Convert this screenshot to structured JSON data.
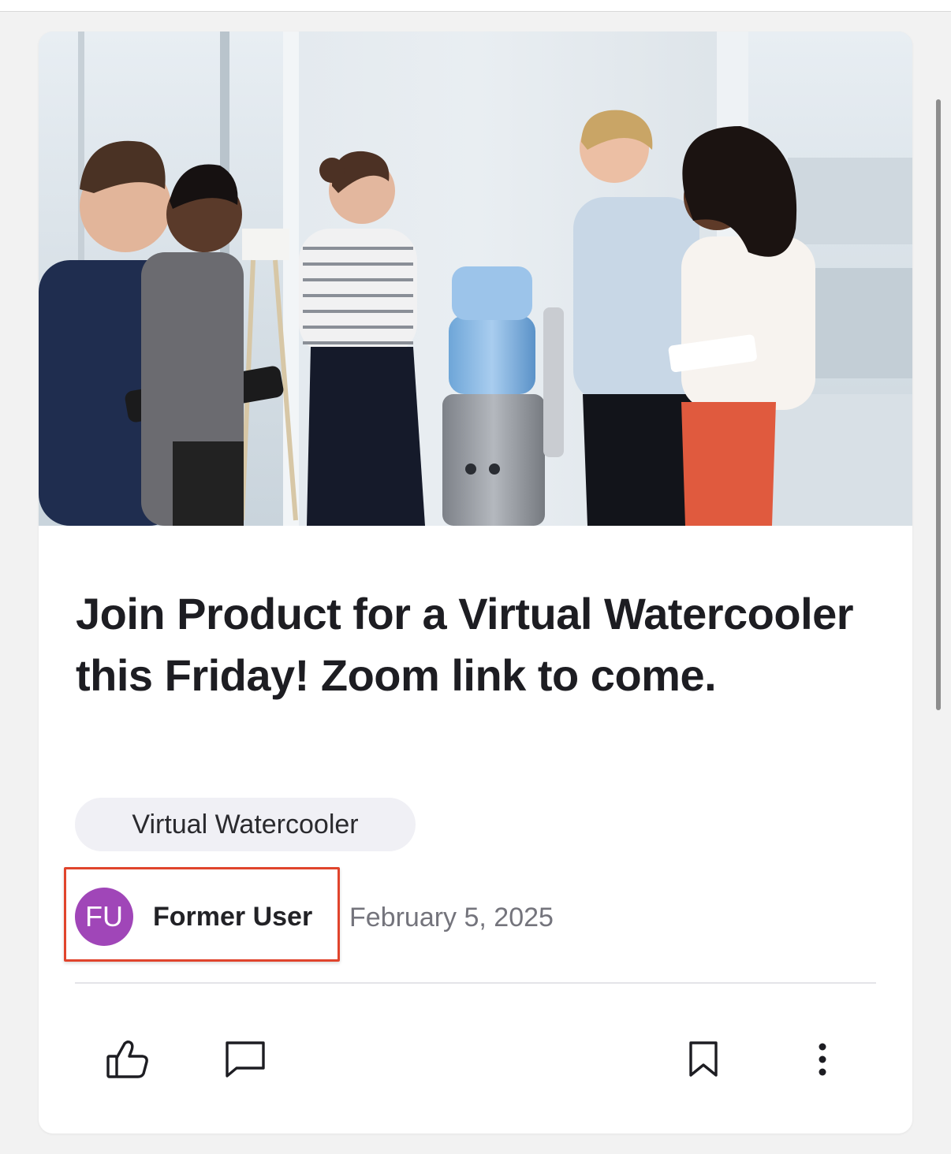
{
  "post": {
    "title": "Join Product for a Virtual Watercooler this Friday! Zoom link to come.",
    "tag": "Virtual Watercooler",
    "author": {
      "initials": "FU",
      "name": "Former User",
      "avatar_color": "#a046b8"
    },
    "date": "February 5, 2025",
    "highlight_color": "#e0442c"
  },
  "actions": {
    "like_icon": "thumbs-up-icon",
    "comment_icon": "comment-icon",
    "bookmark_icon": "bookmark-icon",
    "more_icon": "more-vertical-icon"
  }
}
